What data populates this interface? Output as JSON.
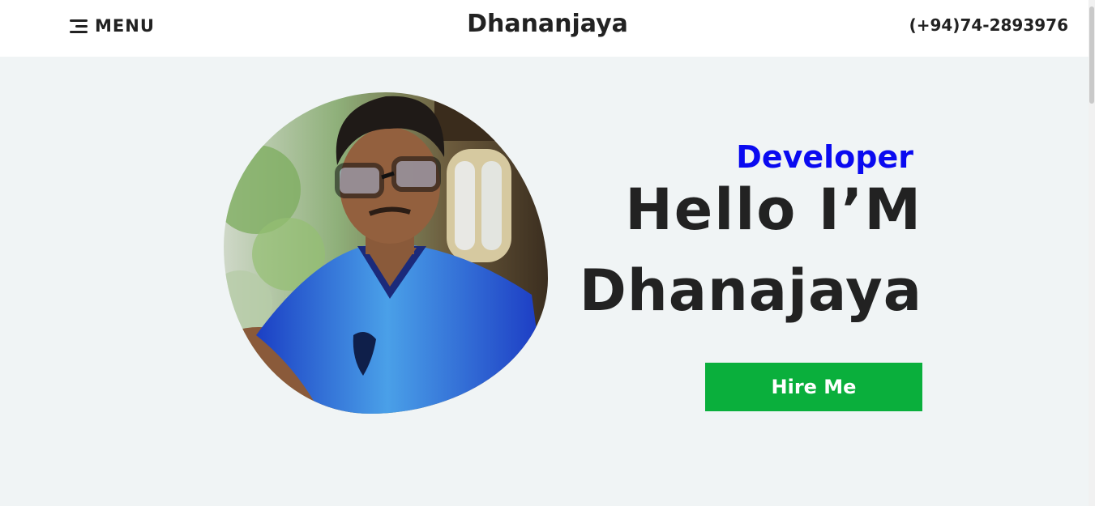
{
  "header": {
    "menu_label": "MENU",
    "brand": "Dhananjaya",
    "phone": "(+94)74-2893976"
  },
  "hero": {
    "role": "Developer",
    "greeting": "Hello I’M",
    "name": "Dhanajaya",
    "cta_label": "Hire Me"
  },
  "colors": {
    "accent_blue": "#0a0af0",
    "cta_green": "#0aaf3c",
    "background": "#f0f4f5",
    "header_bg": "#ffffff",
    "text": "#222222"
  },
  "icons": {
    "menu": "hamburger-menu-icon"
  }
}
